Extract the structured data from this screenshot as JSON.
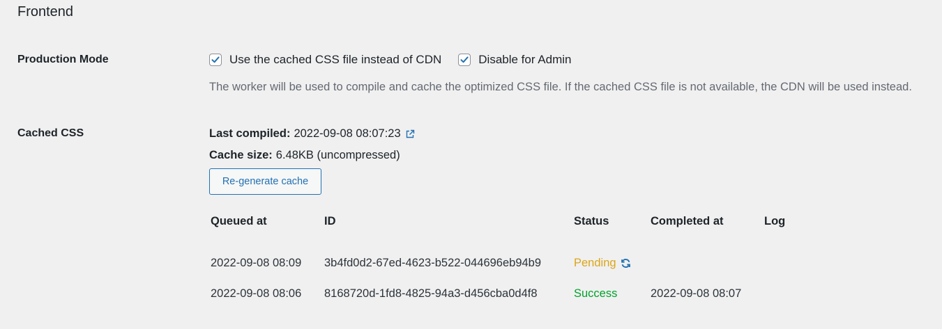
{
  "section": {
    "title": "Frontend"
  },
  "production_mode": {
    "label": "Production Mode",
    "options": [
      {
        "label": "Use the cached CSS file instead of CDN",
        "checked": true
      },
      {
        "label": "Disable for Admin",
        "checked": true
      }
    ],
    "description": "The worker will be used to compile and cache the optimized CSS file. If the cached CSS file is not available, the CDN will be used instead."
  },
  "cached_css": {
    "label": "Cached CSS",
    "last_compiled_label": "Last compiled:",
    "last_compiled_value": "2022-09-08 08:07:23",
    "cache_size_label": "Cache size:",
    "cache_size_value": "6.48KB (uncompressed)",
    "regenerate_button": "Re-generate cache"
  },
  "queue_table": {
    "headers": [
      "Queued at",
      "ID",
      "Status",
      "Completed at",
      "Log"
    ],
    "rows": [
      {
        "queued_at": "2022-09-08 08:09",
        "id": "3b4fd0d2-67ed-4623-b522-044696eb94b9",
        "status": "Pending",
        "completed_at": "",
        "log": ""
      },
      {
        "queued_at": "2022-09-08 08:06",
        "id": "8168720d-1fd8-4825-94a3-d456cba0d4f8",
        "status": "Success",
        "completed_at": "2022-09-08 08:07",
        "log": ""
      }
    ]
  },
  "colors": {
    "accent": "#2271b1",
    "pending": "#dba617",
    "success": "#00a32a",
    "background": "#f0f0f1"
  },
  "icons": [
    "checkmark-icon",
    "external-link-icon",
    "refresh-icon"
  ]
}
